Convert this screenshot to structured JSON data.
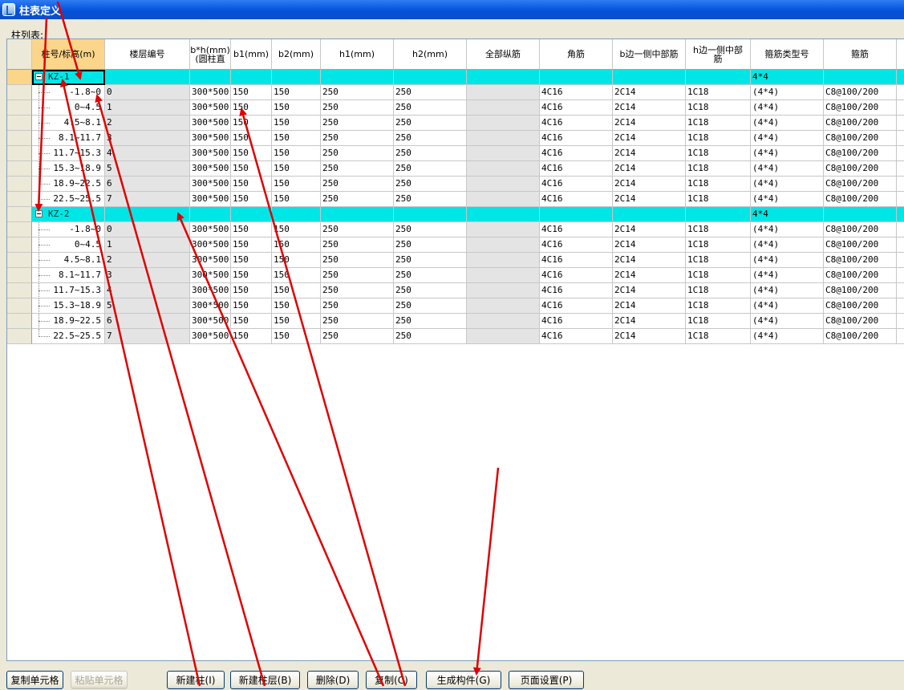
{
  "window": {
    "title": "柱表定义"
  },
  "list_label": "柱列表:",
  "columns": [
    "柱号/标高(m)",
    "楼层编号",
    "b*h(mm)\n(圆柱直",
    "b1(mm)",
    "b2(mm)",
    "h1(mm)",
    "h2(mm)",
    "全部纵筋",
    "角筋",
    "b边一侧中部筋",
    "h边一侧中部\n筋",
    "箍筋类型号",
    "箍筋"
  ],
  "groups": [
    {
      "name": "KZ-1",
      "stirrup_type": "4*4",
      "rows": [
        {
          "elev": "-1.8~0",
          "floor": "0",
          "bh": "300*500",
          "b1": "150",
          "b2": "150",
          "h1": "250",
          "h2": "250",
          "all": "",
          "corner": "4C16",
          "bmid": "2C14",
          "hmid": "1C18",
          "type": "(4*4)",
          "stirrup": "C8@100/200"
        },
        {
          "elev": "0~4.5",
          "floor": "1",
          "bh": "300*500",
          "b1": "150",
          "b2": "150",
          "h1": "250",
          "h2": "250",
          "all": "",
          "corner": "4C16",
          "bmid": "2C14",
          "hmid": "1C18",
          "type": "(4*4)",
          "stirrup": "C8@100/200"
        },
        {
          "elev": "4.5~8.1",
          "floor": "2",
          "bh": "300*500",
          "b1": "150",
          "b2": "150",
          "h1": "250",
          "h2": "250",
          "all": "",
          "corner": "4C16",
          "bmid": "2C14",
          "hmid": "1C18",
          "type": "(4*4)",
          "stirrup": "C8@100/200"
        },
        {
          "elev": "8.1~11.7",
          "floor": "3",
          "bh": "300*500",
          "b1": "150",
          "b2": "150",
          "h1": "250",
          "h2": "250",
          "all": "",
          "corner": "4C16",
          "bmid": "2C14",
          "hmid": "1C18",
          "type": "(4*4)",
          "stirrup": "C8@100/200"
        },
        {
          "elev": "11.7~15.3",
          "floor": "4",
          "bh": "300*500",
          "b1": "150",
          "b2": "150",
          "h1": "250",
          "h2": "250",
          "all": "",
          "corner": "4C16",
          "bmid": "2C14",
          "hmid": "1C18",
          "type": "(4*4)",
          "stirrup": "C8@100/200"
        },
        {
          "elev": "15.3~18.9",
          "floor": "5",
          "bh": "300*500",
          "b1": "150",
          "b2": "150",
          "h1": "250",
          "h2": "250",
          "all": "",
          "corner": "4C16",
          "bmid": "2C14",
          "hmid": "1C18",
          "type": "(4*4)",
          "stirrup": "C8@100/200"
        },
        {
          "elev": "18.9~22.5",
          "floor": "6",
          "bh": "300*500",
          "b1": "150",
          "b2": "150",
          "h1": "250",
          "h2": "250",
          "all": "",
          "corner": "4C16",
          "bmid": "2C14",
          "hmid": "1C18",
          "type": "(4*4)",
          "stirrup": "C8@100/200"
        },
        {
          "elev": "22.5~25.5",
          "floor": "7",
          "bh": "300*500",
          "b1": "150",
          "b2": "150",
          "h1": "250",
          "h2": "250",
          "all": "",
          "corner": "4C16",
          "bmid": "2C14",
          "hmid": "1C18",
          "type": "(4*4)",
          "stirrup": "C8@100/200"
        }
      ]
    },
    {
      "name": "KZ-2",
      "stirrup_type": "4*4",
      "rows": [
        {
          "elev": "-1.8~0",
          "floor": "0",
          "bh": "300*500",
          "b1": "150",
          "b2": "150",
          "h1": "250",
          "h2": "250",
          "all": "",
          "corner": "4C16",
          "bmid": "2C14",
          "hmid": "1C18",
          "type": "(4*4)",
          "stirrup": "C8@100/200"
        },
        {
          "elev": "0~4.5",
          "floor": "1",
          "bh": "300*500",
          "b1": "150",
          "b2": "150",
          "h1": "250",
          "h2": "250",
          "all": "",
          "corner": "4C16",
          "bmid": "2C14",
          "hmid": "1C18",
          "type": "(4*4)",
          "stirrup": "C8@100/200"
        },
        {
          "elev": "4.5~8.1",
          "floor": "2",
          "bh": "300*500",
          "b1": "150",
          "b2": "150",
          "h1": "250",
          "h2": "250",
          "all": "",
          "corner": "4C16",
          "bmid": "2C14",
          "hmid": "1C18",
          "type": "(4*4)",
          "stirrup": "C8@100/200"
        },
        {
          "elev": "8.1~11.7",
          "floor": "3",
          "bh": "300*500",
          "b1": "150",
          "b2": "150",
          "h1": "250",
          "h2": "250",
          "all": "",
          "corner": "4C16",
          "bmid": "2C14",
          "hmid": "1C18",
          "type": "(4*4)",
          "stirrup": "C8@100/200"
        },
        {
          "elev": "11.7~15.3",
          "floor": "4",
          "bh": "300*500",
          "b1": "150",
          "b2": "150",
          "h1": "250",
          "h2": "250",
          "all": "",
          "corner": "4C16",
          "bmid": "2C14",
          "hmid": "1C18",
          "type": "(4*4)",
          "stirrup": "C8@100/200"
        },
        {
          "elev": "15.3~18.9",
          "floor": "5",
          "bh": "300*500",
          "b1": "150",
          "b2": "150",
          "h1": "250",
          "h2": "250",
          "all": "",
          "corner": "4C16",
          "bmid": "2C14",
          "hmid": "1C18",
          "type": "(4*4)",
          "stirrup": "C8@100/200"
        },
        {
          "elev": "18.9~22.5",
          "floor": "6",
          "bh": "300*500",
          "b1": "150",
          "b2": "150",
          "h1": "250",
          "h2": "250",
          "all": "",
          "corner": "4C16",
          "bmid": "2C14",
          "hmid": "1C18",
          "type": "(4*4)",
          "stirrup": "C8@100/200"
        },
        {
          "elev": "22.5~25.5",
          "floor": "7",
          "bh": "300*500",
          "b1": "150",
          "b2": "150",
          "h1": "250",
          "h2": "250",
          "all": "",
          "corner": "4C16",
          "bmid": "2C14",
          "hmid": "1C18",
          "type": "(4*4)",
          "stirrup": "C8@100/200"
        }
      ]
    }
  ],
  "buttons": {
    "copy_cell": "复制单元格",
    "paste_cell": "粘贴单元格",
    "new_column": "新建柱(I)",
    "new_floor": "新建柱层(B)",
    "delete": "删除(D)",
    "copy": "复制(C)",
    "generate": "生成构件(G)",
    "page_setup": "页面设置(P)"
  },
  "colors": {
    "title_bar": "#0a59e0",
    "group_row": "#00e6e6",
    "active_header": "#fbd58a",
    "annotation_arrow": "#e00000"
  }
}
